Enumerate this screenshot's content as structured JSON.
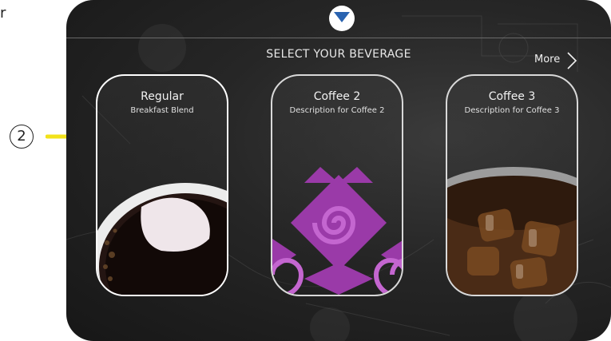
{
  "annotation": {
    "margin_letter": "r",
    "callout_number": "2",
    "arrow_color": "#f2e21a"
  },
  "header": {
    "title": "SELECT YOUR BEVERAGE",
    "more_label": "More"
  },
  "cards": [
    {
      "title": "Regular",
      "description": "Breakfast Blend",
      "selected": true,
      "art": "hot-coffee-cup-image"
    },
    {
      "title": "Coffee 2",
      "description": "Description for Coffee 2",
      "selected": false,
      "art": "purple-spiral-pattern-image"
    },
    {
      "title": "Coffee 3",
      "description": "Description for Coffee 3",
      "selected": false,
      "art": "iced-coffee-glass-image"
    }
  ],
  "colors": {
    "accent_logo": "#2a63b0",
    "card_pattern": "#9a3aa8",
    "screen_bg": "#262626"
  }
}
